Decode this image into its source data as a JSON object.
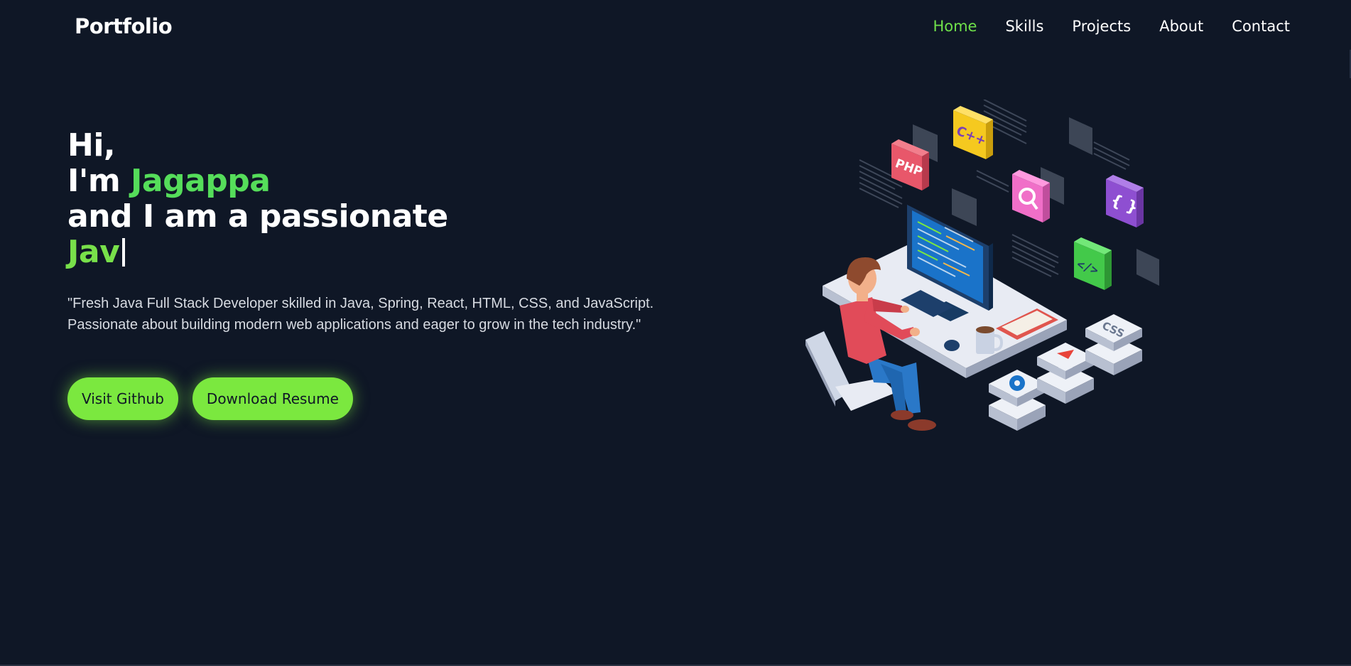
{
  "navbar": {
    "brand": "Portfolio",
    "links": [
      {
        "label": "Home",
        "active": true
      },
      {
        "label": "Skills",
        "active": false
      },
      {
        "label": "Projects",
        "active": false
      },
      {
        "label": "About",
        "active": false
      },
      {
        "label": "Contact",
        "active": false
      }
    ]
  },
  "hero": {
    "greeting": "Hi,",
    "intro_prefix": "I'm ",
    "name": "Jagappa",
    "tagline": "and I am a passionate",
    "typed_text": "Jav",
    "description": "\"Fresh Java Full Stack Developer skilled in Java, Spring, React, HTML, CSS, and JavaScript. Passionate about building modern web applications and eager to grow in the tech industry.\"",
    "buttons": {
      "github_label": "Visit Github",
      "resume_label": "Download Resume"
    }
  },
  "illustration": {
    "badges": [
      "PHP",
      "C++",
      "{ }",
      "</>",
      "CSS"
    ]
  },
  "colors": {
    "background": "#0f1726",
    "accent": "#7be83f",
    "active_nav": "#6fe04a"
  }
}
